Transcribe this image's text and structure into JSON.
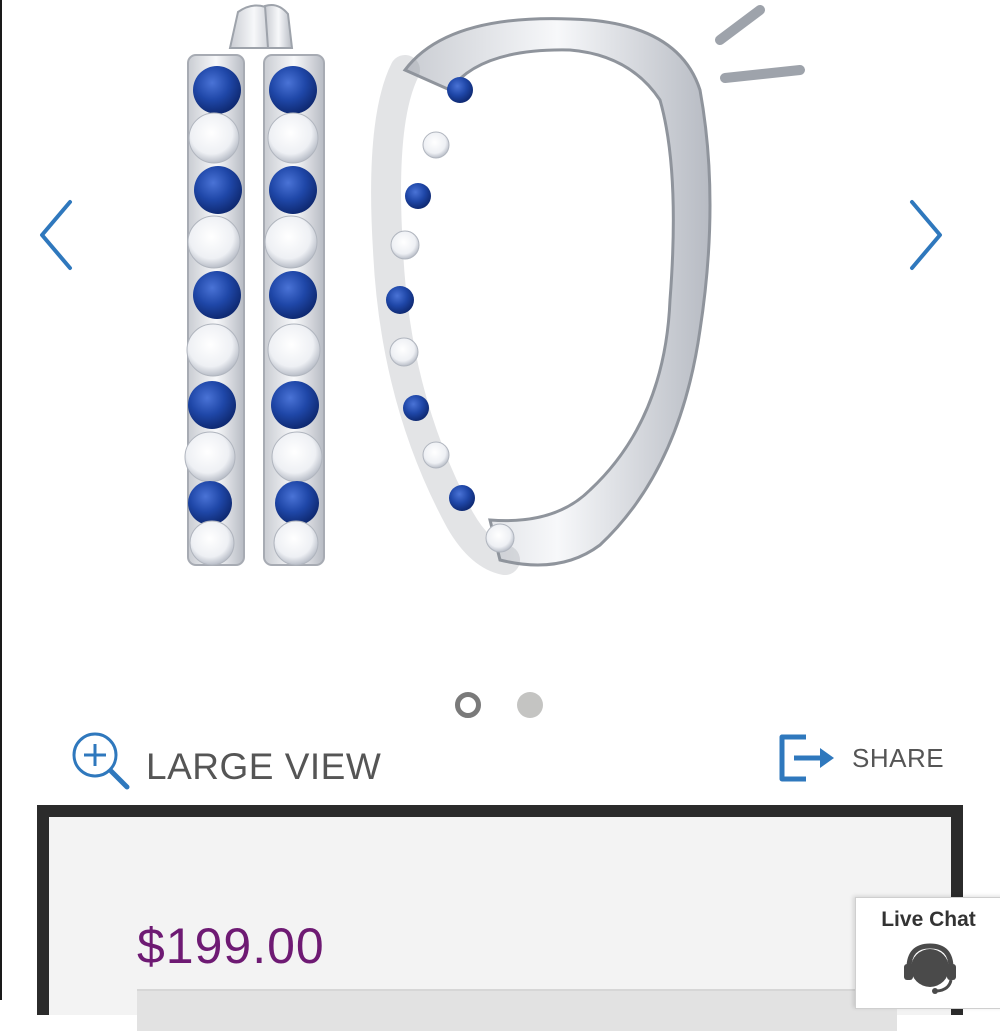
{
  "gallery": {
    "image_alt": "Sapphire and white sapphire hoop earrings in sterling silver",
    "dots_total": 2,
    "active_dot": 1
  },
  "actions": {
    "large_view_label": "LARGE VIEW",
    "share_label": "SHARE"
  },
  "product": {
    "price": "$199.00"
  },
  "live_chat": {
    "label": "Live Chat"
  },
  "colors": {
    "accent_blue": "#2f78bd",
    "price_purple": "#6e1a73",
    "sapphire": "#1f47a8"
  }
}
